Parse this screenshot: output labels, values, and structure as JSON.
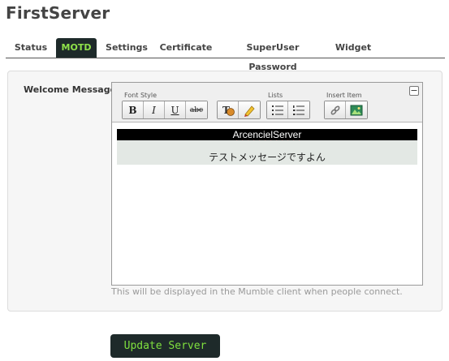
{
  "page": {
    "title": "FirstServer"
  },
  "tabs": [
    {
      "label": "Status"
    },
    {
      "label": "MOTD",
      "active": true
    },
    {
      "label": "Settings"
    },
    {
      "label": "Certificate"
    },
    {
      "label": "SuperUser Password"
    },
    {
      "label": "Widget"
    }
  ],
  "form": {
    "welcome_label": "Welcome Message",
    "help_text": "This will be displayed in the Mumble client when people connect.",
    "submit_label": "Update Server"
  },
  "editor": {
    "groups": {
      "font_style": "Font Style",
      "lists": "Lists",
      "insert_item": "Insert Item"
    },
    "buttons": {
      "bold": "B",
      "italic": "I",
      "underline": "U",
      "strike": "abc"
    },
    "collapse": "−",
    "content": {
      "line1": "ArcencielServer",
      "line2": "テストメッセージですよん"
    }
  },
  "colors": {
    "accent_dark": "#1e2a2a",
    "accent_green": "#8fe24a"
  }
}
